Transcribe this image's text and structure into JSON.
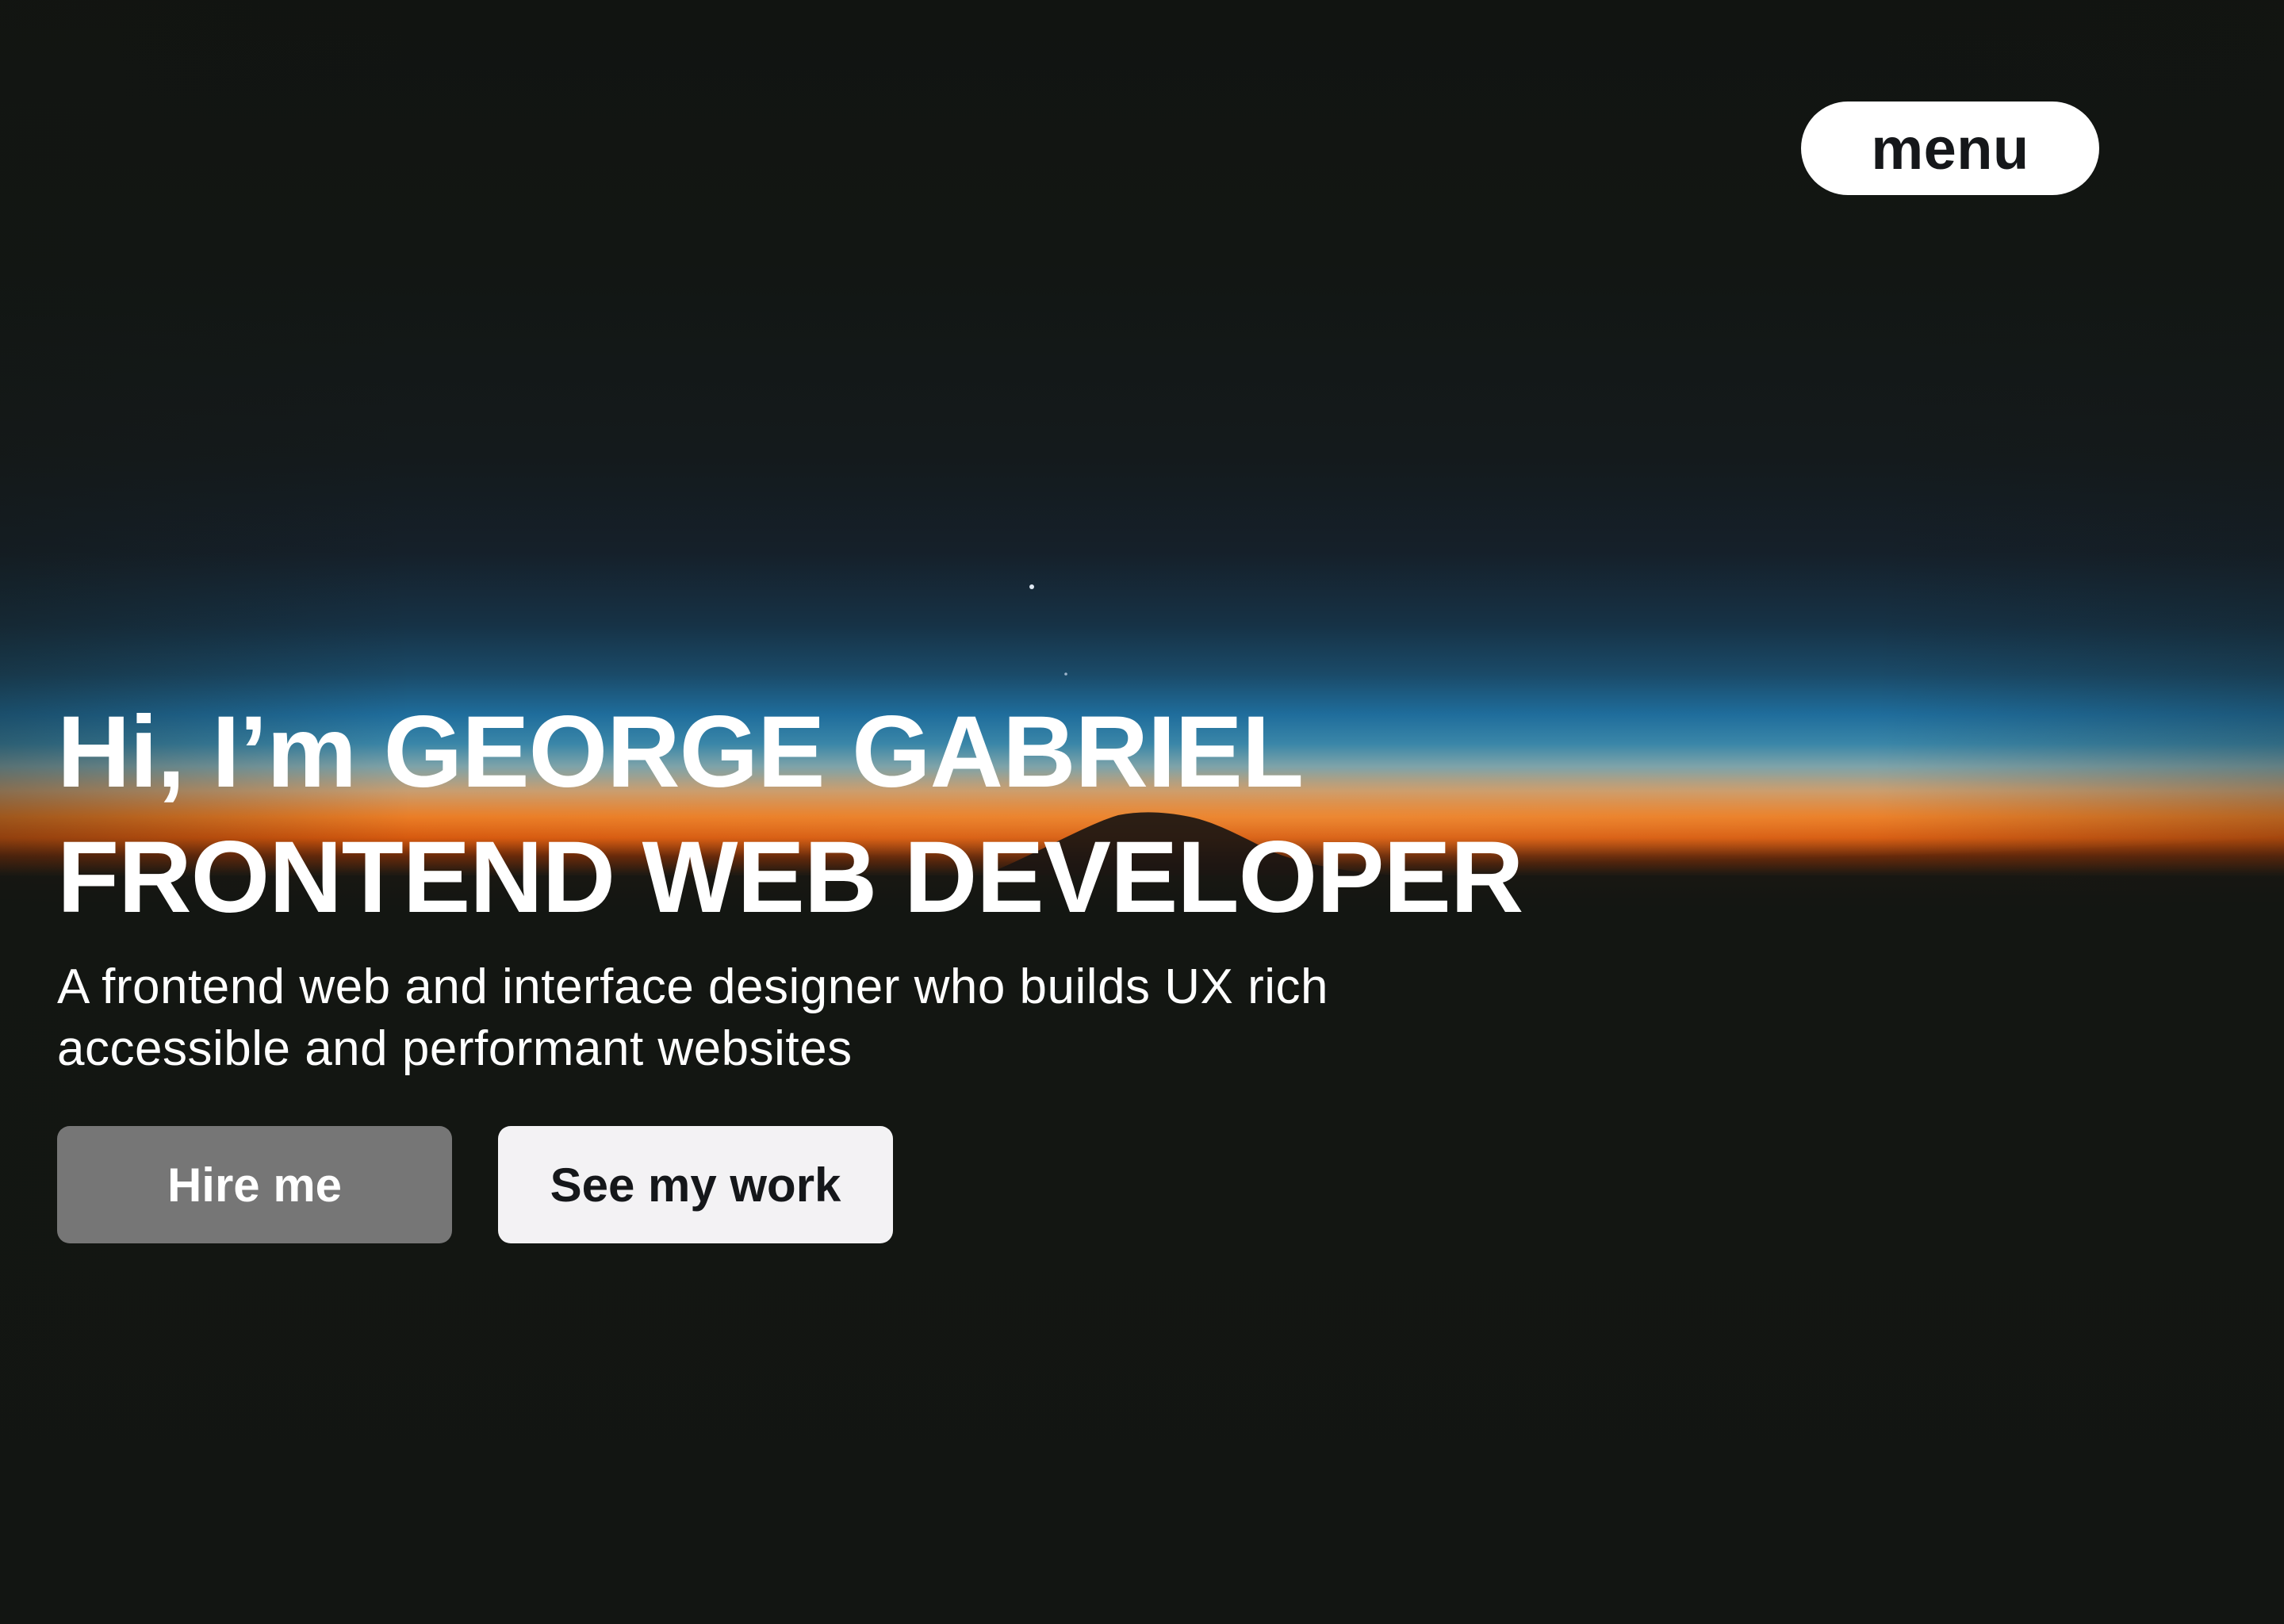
{
  "nav": {
    "menu_label": "menu"
  },
  "hero": {
    "headline_line1": "Hi, I’m GEORGE GABRIEL",
    "headline_line2": "FRONTEND WEB DEVELOPER",
    "subtitle": "A frontend web and interface designer who builds UX rich accessible and performant websites",
    "background_image": "sunset-horizon-photo"
  },
  "actions": {
    "hire_label": "Hire me",
    "work_label": "See my work"
  },
  "colors": {
    "page_background": "#131612",
    "hire_button": "#767676",
    "work_button": "#f3f2f4",
    "text_light": "#ffffff",
    "text_dark": "#15171a",
    "horizon_orange": "#e8650f",
    "sky_blue": "#1f6d9c"
  }
}
